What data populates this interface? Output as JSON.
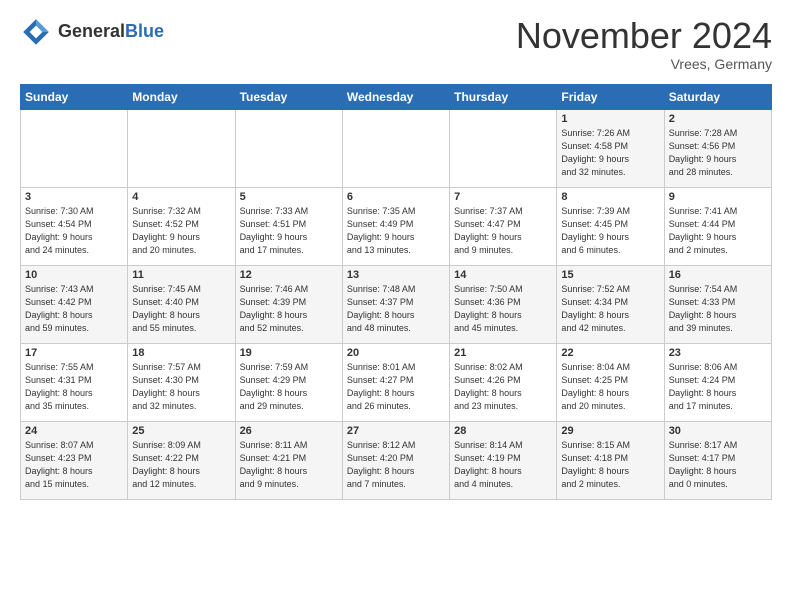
{
  "header": {
    "logo_general": "General",
    "logo_blue": "Blue",
    "title": "November 2024",
    "location": "Vrees, Germany"
  },
  "weekdays": [
    "Sunday",
    "Monday",
    "Tuesday",
    "Wednesday",
    "Thursday",
    "Friday",
    "Saturday"
  ],
  "weeks": [
    [
      {
        "day": "",
        "info": ""
      },
      {
        "day": "",
        "info": ""
      },
      {
        "day": "",
        "info": ""
      },
      {
        "day": "",
        "info": ""
      },
      {
        "day": "",
        "info": ""
      },
      {
        "day": "1",
        "info": "Sunrise: 7:26 AM\nSunset: 4:58 PM\nDaylight: 9 hours\nand 32 minutes."
      },
      {
        "day": "2",
        "info": "Sunrise: 7:28 AM\nSunset: 4:56 PM\nDaylight: 9 hours\nand 28 minutes."
      }
    ],
    [
      {
        "day": "3",
        "info": "Sunrise: 7:30 AM\nSunset: 4:54 PM\nDaylight: 9 hours\nand 24 minutes."
      },
      {
        "day": "4",
        "info": "Sunrise: 7:32 AM\nSunset: 4:52 PM\nDaylight: 9 hours\nand 20 minutes."
      },
      {
        "day": "5",
        "info": "Sunrise: 7:33 AM\nSunset: 4:51 PM\nDaylight: 9 hours\nand 17 minutes."
      },
      {
        "day": "6",
        "info": "Sunrise: 7:35 AM\nSunset: 4:49 PM\nDaylight: 9 hours\nand 13 minutes."
      },
      {
        "day": "7",
        "info": "Sunrise: 7:37 AM\nSunset: 4:47 PM\nDaylight: 9 hours\nand 9 minutes."
      },
      {
        "day": "8",
        "info": "Sunrise: 7:39 AM\nSunset: 4:45 PM\nDaylight: 9 hours\nand 6 minutes."
      },
      {
        "day": "9",
        "info": "Sunrise: 7:41 AM\nSunset: 4:44 PM\nDaylight: 9 hours\nand 2 minutes."
      }
    ],
    [
      {
        "day": "10",
        "info": "Sunrise: 7:43 AM\nSunset: 4:42 PM\nDaylight: 8 hours\nand 59 minutes."
      },
      {
        "day": "11",
        "info": "Sunrise: 7:45 AM\nSunset: 4:40 PM\nDaylight: 8 hours\nand 55 minutes."
      },
      {
        "day": "12",
        "info": "Sunrise: 7:46 AM\nSunset: 4:39 PM\nDaylight: 8 hours\nand 52 minutes."
      },
      {
        "day": "13",
        "info": "Sunrise: 7:48 AM\nSunset: 4:37 PM\nDaylight: 8 hours\nand 48 minutes."
      },
      {
        "day": "14",
        "info": "Sunrise: 7:50 AM\nSunset: 4:36 PM\nDaylight: 8 hours\nand 45 minutes."
      },
      {
        "day": "15",
        "info": "Sunrise: 7:52 AM\nSunset: 4:34 PM\nDaylight: 8 hours\nand 42 minutes."
      },
      {
        "day": "16",
        "info": "Sunrise: 7:54 AM\nSunset: 4:33 PM\nDaylight: 8 hours\nand 39 minutes."
      }
    ],
    [
      {
        "day": "17",
        "info": "Sunrise: 7:55 AM\nSunset: 4:31 PM\nDaylight: 8 hours\nand 35 minutes."
      },
      {
        "day": "18",
        "info": "Sunrise: 7:57 AM\nSunset: 4:30 PM\nDaylight: 8 hours\nand 32 minutes."
      },
      {
        "day": "19",
        "info": "Sunrise: 7:59 AM\nSunset: 4:29 PM\nDaylight: 8 hours\nand 29 minutes."
      },
      {
        "day": "20",
        "info": "Sunrise: 8:01 AM\nSunset: 4:27 PM\nDaylight: 8 hours\nand 26 minutes."
      },
      {
        "day": "21",
        "info": "Sunrise: 8:02 AM\nSunset: 4:26 PM\nDaylight: 8 hours\nand 23 minutes."
      },
      {
        "day": "22",
        "info": "Sunrise: 8:04 AM\nSunset: 4:25 PM\nDaylight: 8 hours\nand 20 minutes."
      },
      {
        "day": "23",
        "info": "Sunrise: 8:06 AM\nSunset: 4:24 PM\nDaylight: 8 hours\nand 17 minutes."
      }
    ],
    [
      {
        "day": "24",
        "info": "Sunrise: 8:07 AM\nSunset: 4:23 PM\nDaylight: 8 hours\nand 15 minutes."
      },
      {
        "day": "25",
        "info": "Sunrise: 8:09 AM\nSunset: 4:22 PM\nDaylight: 8 hours\nand 12 minutes."
      },
      {
        "day": "26",
        "info": "Sunrise: 8:11 AM\nSunset: 4:21 PM\nDaylight: 8 hours\nand 9 minutes."
      },
      {
        "day": "27",
        "info": "Sunrise: 8:12 AM\nSunset: 4:20 PM\nDaylight: 8 hours\nand 7 minutes."
      },
      {
        "day": "28",
        "info": "Sunrise: 8:14 AM\nSunset: 4:19 PM\nDaylight: 8 hours\nand 4 minutes."
      },
      {
        "day": "29",
        "info": "Sunrise: 8:15 AM\nSunset: 4:18 PM\nDaylight: 8 hours\nand 2 minutes."
      },
      {
        "day": "30",
        "info": "Sunrise: 8:17 AM\nSunset: 4:17 PM\nDaylight: 8 hours\nand 0 minutes."
      }
    ]
  ]
}
